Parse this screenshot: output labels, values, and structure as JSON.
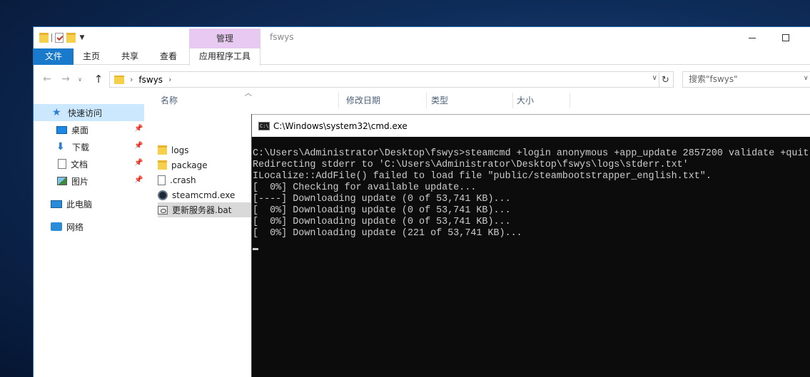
{
  "explorer": {
    "window_title": "fswys",
    "context_tab_group": "管理",
    "ribbon_tabs": [
      "文件",
      "主页",
      "共享",
      "查看",
      "应用程序工具"
    ],
    "address": {
      "path_segment": "fswys"
    },
    "search": {
      "placeholder": "搜索\"fswys\""
    },
    "nav_pane": {
      "quick_access": "快速访问",
      "items": [
        {
          "label": "桌面",
          "icon": "desktop-icon",
          "pinned": true
        },
        {
          "label": "下载",
          "icon": "download-icon",
          "pinned": true
        },
        {
          "label": "文档",
          "icon": "documents-icon",
          "pinned": true
        },
        {
          "label": "图片",
          "icon": "pictures-icon",
          "pinned": true
        }
      ],
      "this_pc": "此电脑",
      "network": "网络"
    },
    "columns": [
      "名称",
      "修改日期",
      "类型",
      "大小"
    ],
    "files": [
      {
        "name": "logs",
        "icon": "folder-icon"
      },
      {
        "name": "package",
        "icon": "folder-icon"
      },
      {
        "name": ".crash",
        "icon": "file-icon"
      },
      {
        "name": "steamcmd.exe",
        "icon": "steam-icon"
      },
      {
        "name": "更新服务器.bat",
        "icon": "batch-file-icon",
        "selected": true
      }
    ]
  },
  "cmd": {
    "title": "C:\\Windows\\system32\\cmd.exe",
    "lines": [
      "C:\\Users\\Administrator\\Desktop\\fswys>steamcmd +login anonymous +app_update 2857200 validate +quit",
      "Redirecting stderr to 'C:\\Users\\Administrator\\Desktop\\fswys\\logs\\stderr.txt'",
      "ILocalize::AddFile() failed to load file \"public/steambootstrapper_english.txt\".",
      "[  0%] Checking for available update...",
      "[----] Downloading update (0 of 53,741 KB)...",
      "[  0%] Downloading update (0 of 53,741 KB)...",
      "[  0%] Downloading update (0 of 53,741 KB)...",
      "[  0%] Downloading update (221 of 53,741 KB)..."
    ]
  }
}
